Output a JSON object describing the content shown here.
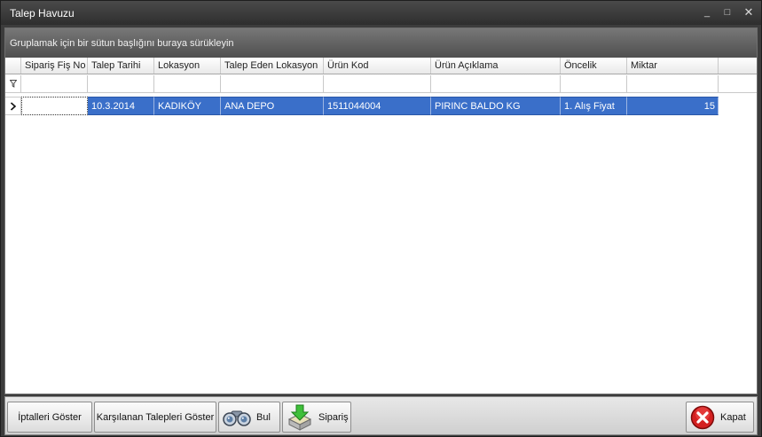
{
  "window": {
    "title": "Talep Havuzu",
    "controls": {
      "minimize": "_",
      "maximize": "□",
      "close": "✕"
    }
  },
  "group_panel": {
    "hint": "Gruplamak için bir sütun başlığını buraya sürükleyin"
  },
  "grid": {
    "columns": [
      "Sipariş Fiş No",
      "Talep Tarihi",
      "Lokasyon",
      "Talep Eden Lokasyon",
      "Ürün Kod",
      "Ürün Açıklama",
      "Öncelik",
      "Miktar"
    ],
    "rows": [
      {
        "siparis_fis_no": "",
        "talep_tarihi": "10.3.2014",
        "lokasyon": "KADIKÖY",
        "talep_eden_lokasyon": "ANA DEPO",
        "urun_kod": "1511044004",
        "urun_aciklama": "PIRINC BALDO KG",
        "oncelik": "1. Alış Fiyat",
        "miktar": "15"
      }
    ]
  },
  "buttons": {
    "iptalleri_goster": "İptalleri Göster",
    "karsilanan": "Karşılanan Talepleri Göster",
    "bul": "Bul",
    "siparis": "Sipariş",
    "kapat": "Kapat"
  },
  "icons": {
    "bul": "binoculars-icon",
    "siparis": "order-download-icon",
    "kapat": "close-red-icon",
    "filter": "filter-funnel-icon",
    "row_indicator": "row-pointer-icon"
  },
  "colors": {
    "selection": "#3a6fc9",
    "titlebar": "#3c3c3c",
    "close_red": "#d42020"
  }
}
